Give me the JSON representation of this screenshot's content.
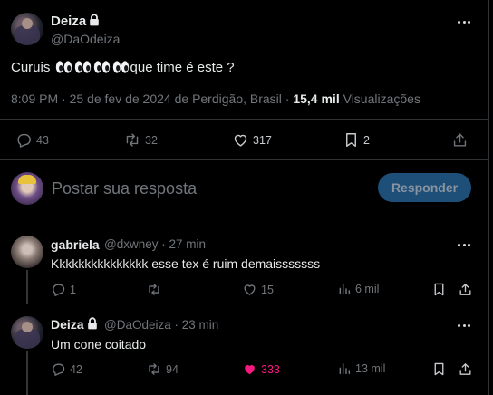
{
  "main_post": {
    "author_name": "Deiza",
    "author_handle": "@DaOdeiza",
    "text_prefix": "Curuis",
    "text_suffix": "que time é este ?",
    "eyes_count": 4,
    "time": "8:09 PM",
    "date": "25 de fev de 2024",
    "location_prefix": "de",
    "location": "Perdigão, Brasil",
    "views_count": "15,4 mil",
    "views_label": "Visualizações",
    "replies": "43",
    "reposts": "32",
    "likes": "317",
    "bookmarks": "2"
  },
  "composer": {
    "placeholder": "Postar sua resposta",
    "button_label": "Responder"
  },
  "replies": [
    {
      "author_name": "gabriela",
      "author_handle": "@dxwney",
      "time_ago": "27 min",
      "text": "Kkkkkkkkkkkkkkk esse tex é ruim demaisssssss",
      "replies": "1",
      "reposts": "",
      "likes": "15",
      "views": "6 mil"
    },
    {
      "author_name": "Deiza",
      "author_handle": "@DaOdeiza",
      "time_ago": "23 min",
      "text": "Um cone coitado",
      "replies": "42",
      "reposts": "94",
      "likes": "333",
      "views": "13 mil"
    }
  ],
  "colors": {
    "background": "#000000",
    "text": "#e7e9ea",
    "muted": "#71767b",
    "divider": "#2f3336",
    "accent_button": "#1d4f79",
    "like_pink": "#f91880"
  }
}
